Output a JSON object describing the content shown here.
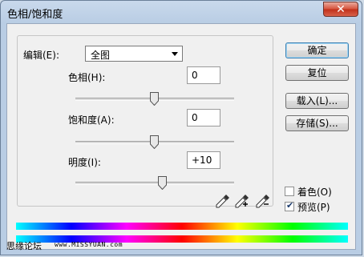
{
  "window": {
    "title": "色相/饱和度",
    "close_icon": "close-icon"
  },
  "edit": {
    "label": "编辑(E):",
    "value": "全图"
  },
  "hue": {
    "label": "色相(H):",
    "value": "0",
    "slider_position_percent": 50
  },
  "saturation": {
    "label": "饱和度(A):",
    "value": "0",
    "slider_position_percent": 50
  },
  "lightness": {
    "label": "明度(I):",
    "value": "+10",
    "slider_position_percent": 55
  },
  "buttons": {
    "ok": "确定",
    "reset": "复位",
    "load": "载入(L)...",
    "save": "存储(S)..."
  },
  "options": {
    "colorize": {
      "label": "着色(O)",
      "checked": false
    },
    "preview": {
      "label": "预览(P)",
      "checked": true
    }
  },
  "eyedroppers": [
    "eyedropper-icon",
    "eyedropper-plus-icon",
    "eyedropper-minus-icon"
  ],
  "watermark": {
    "text": "思缘论坛",
    "url": "www.MISSYUAN.com"
  }
}
